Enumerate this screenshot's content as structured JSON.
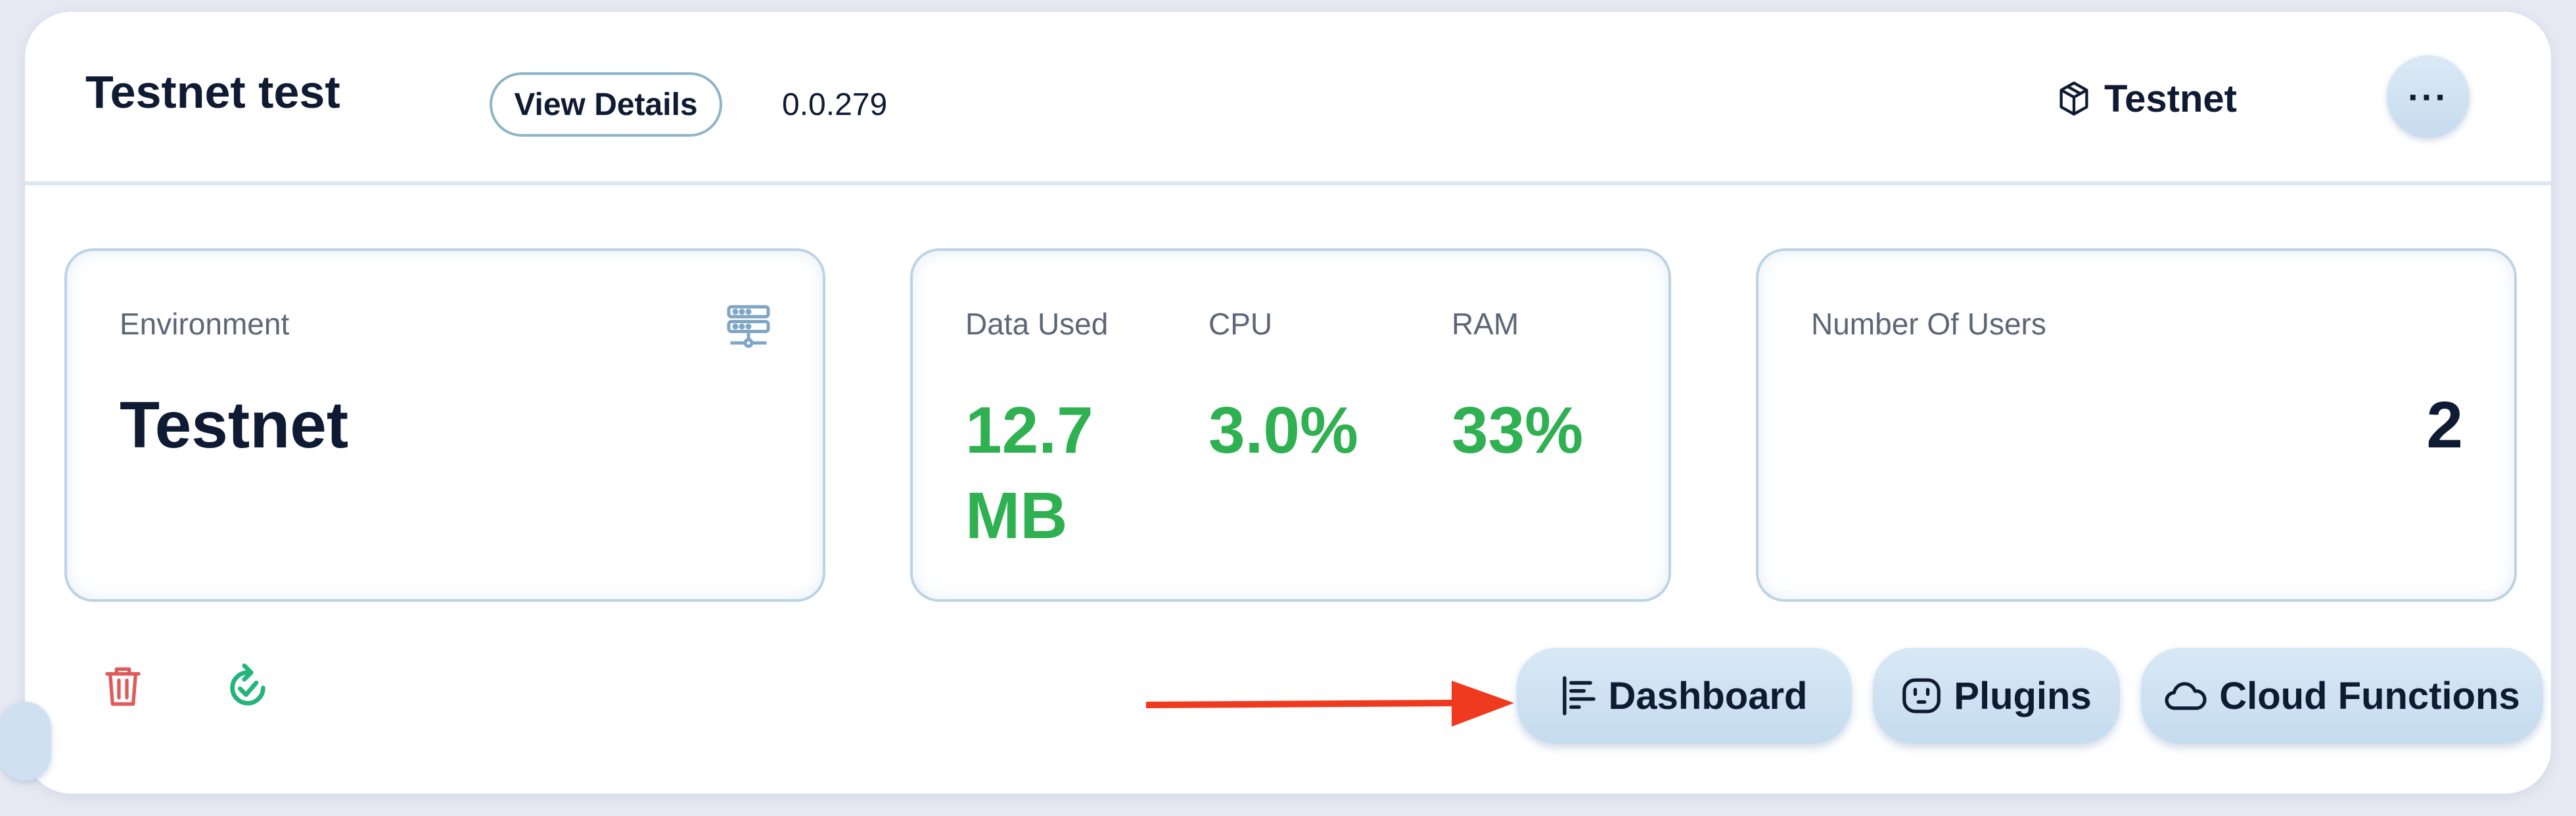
{
  "header": {
    "title": "Testnet test",
    "view_details_label": "View Details",
    "version": "0.0.279",
    "network_label": "Testnet",
    "network_icon": "cube-icon",
    "more_label": "···"
  },
  "stats": {
    "environment": {
      "label": "Environment",
      "value": "Testnet",
      "icon": "server-icon"
    },
    "resources": {
      "data_used_label": "Data Used",
      "data_used_value_line1": "12.7",
      "data_used_value_line2": "MB",
      "cpu_label": "CPU",
      "cpu_value": "3.0%",
      "ram_label": "RAM",
      "ram_value": "33%"
    },
    "users": {
      "label": "Number Of Users",
      "value": "2"
    }
  },
  "actions": {
    "dashboard_label": "Dashboard",
    "plugins_label": "Plugins",
    "cloud_functions_label": "Cloud Functions"
  },
  "colors": {
    "accent_green": "#2fb051",
    "trash_red": "#e05a5a",
    "refresh_green": "#23b57a",
    "arrow_red": "#f03a1f",
    "text_dark": "#0f1a33",
    "button_blue": "#cfe2f2"
  }
}
